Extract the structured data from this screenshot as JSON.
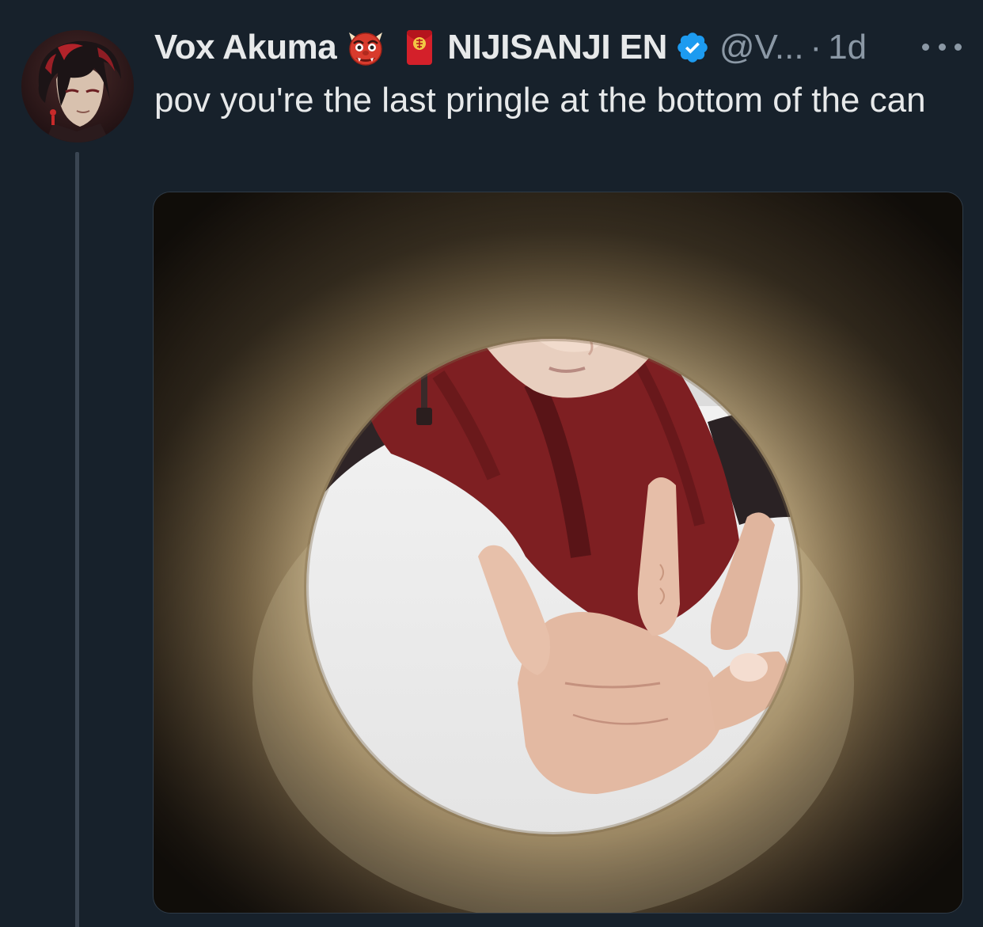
{
  "tweet": {
    "display_name": "Vox Akuma",
    "org_name": "NIJISANJI EN",
    "handle": "@V...",
    "separator": "·",
    "timestamp": "1d",
    "text": "pov you're the last pringle at the bottom of the can"
  },
  "icons": {
    "name_emoji": "ogre-emoji-icon",
    "org_emoji": "red-envelope-emoji-icon",
    "verified": "verified-badge-icon",
    "more": "more-options-icon"
  },
  "colors": {
    "background": "#17212b",
    "text_primary": "#e7e9ea",
    "text_secondary": "#8b98a5",
    "verified_blue": "#1d9bf0",
    "thread_line": "#3a4552"
  }
}
